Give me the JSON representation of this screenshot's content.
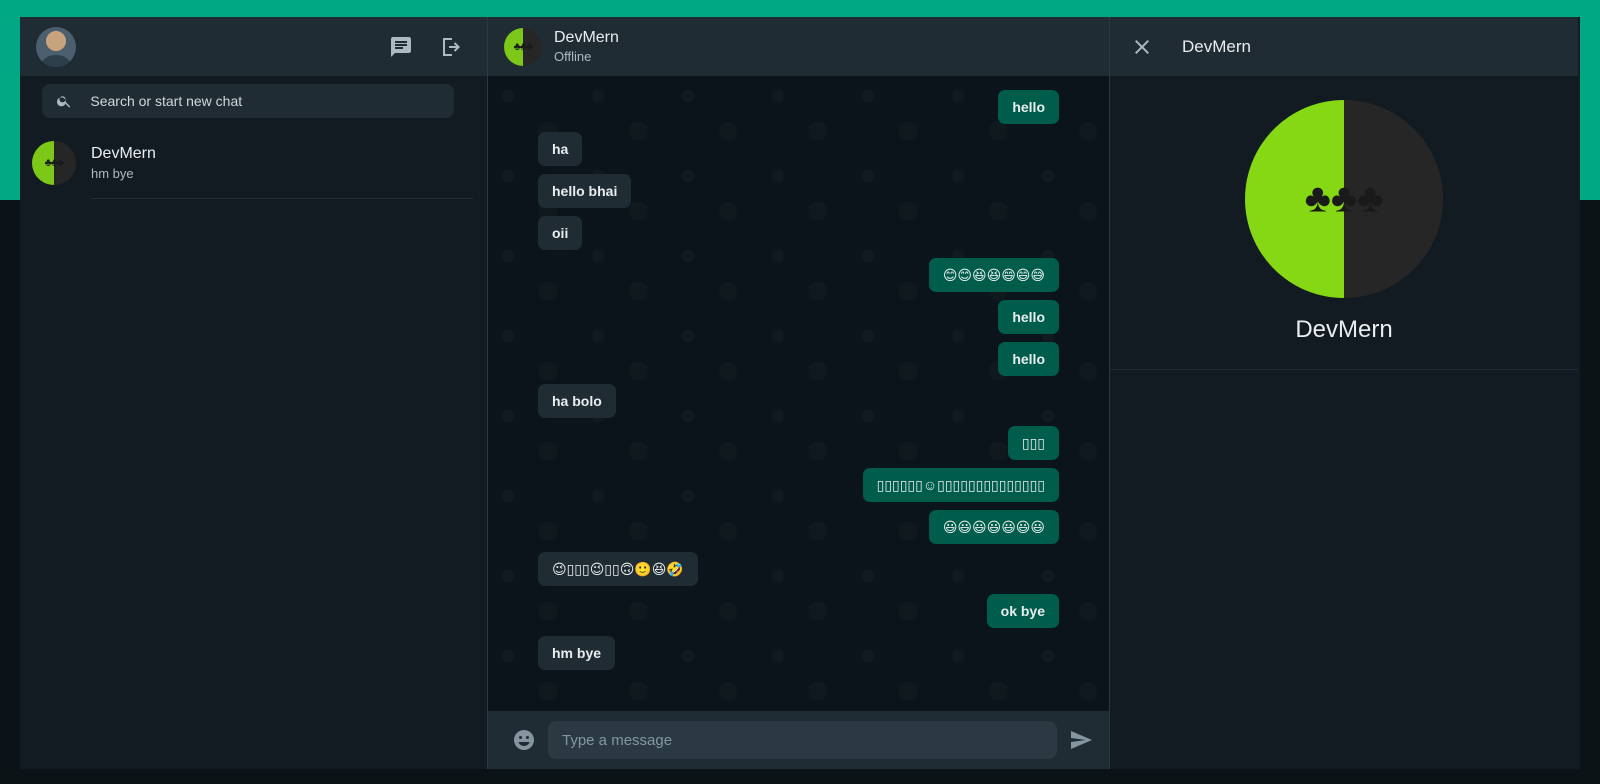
{
  "sidebar": {
    "search": {
      "placeholder": "Search or start new chat"
    },
    "chats": [
      {
        "name": "DevMern",
        "last_message": "hm bye"
      }
    ],
    "icons": [
      "new-chat-icon",
      "logout-icon",
      "search-icon"
    ]
  },
  "conversation": {
    "contact_name": "DevMern",
    "status": "Offline",
    "messages": [
      {
        "dir": "out",
        "text": "hello"
      },
      {
        "dir": "in",
        "text": "ha"
      },
      {
        "dir": "in",
        "text": "hello bhai"
      },
      {
        "dir": "in",
        "text": "oii"
      },
      {
        "dir": "out",
        "text": "😊😊😆😆😄😄😅"
      },
      {
        "dir": "out",
        "text": "hello"
      },
      {
        "dir": "out",
        "text": "hello"
      },
      {
        "dir": "in",
        "text": "ha bolo"
      },
      {
        "dir": "out",
        "text": "▯▯▯"
      },
      {
        "dir": "out",
        "text": "▯▯▯▯▯▯☺▯▯▯▯▯▯▯▯▯▯▯▯▯▯"
      },
      {
        "dir": "out",
        "text": "😃😃😃😃😃😃😃"
      },
      {
        "dir": "in",
        "text": "😉▯▯▯😉▯▯🙃🙂😆🤣"
      },
      {
        "dir": "out",
        "text": "ok bye"
      },
      {
        "dir": "in",
        "text": "hm bye"
      }
    ],
    "composer": {
      "placeholder": "Type a message"
    }
  },
  "contact_info": {
    "title": "DevMern",
    "name": "DevMern"
  },
  "colors": {
    "accent": "#00a884",
    "outgoing_bubble": "#005c4b",
    "incoming_bubble": "#202c33",
    "panel": "#202c33",
    "background": "#111b21"
  }
}
